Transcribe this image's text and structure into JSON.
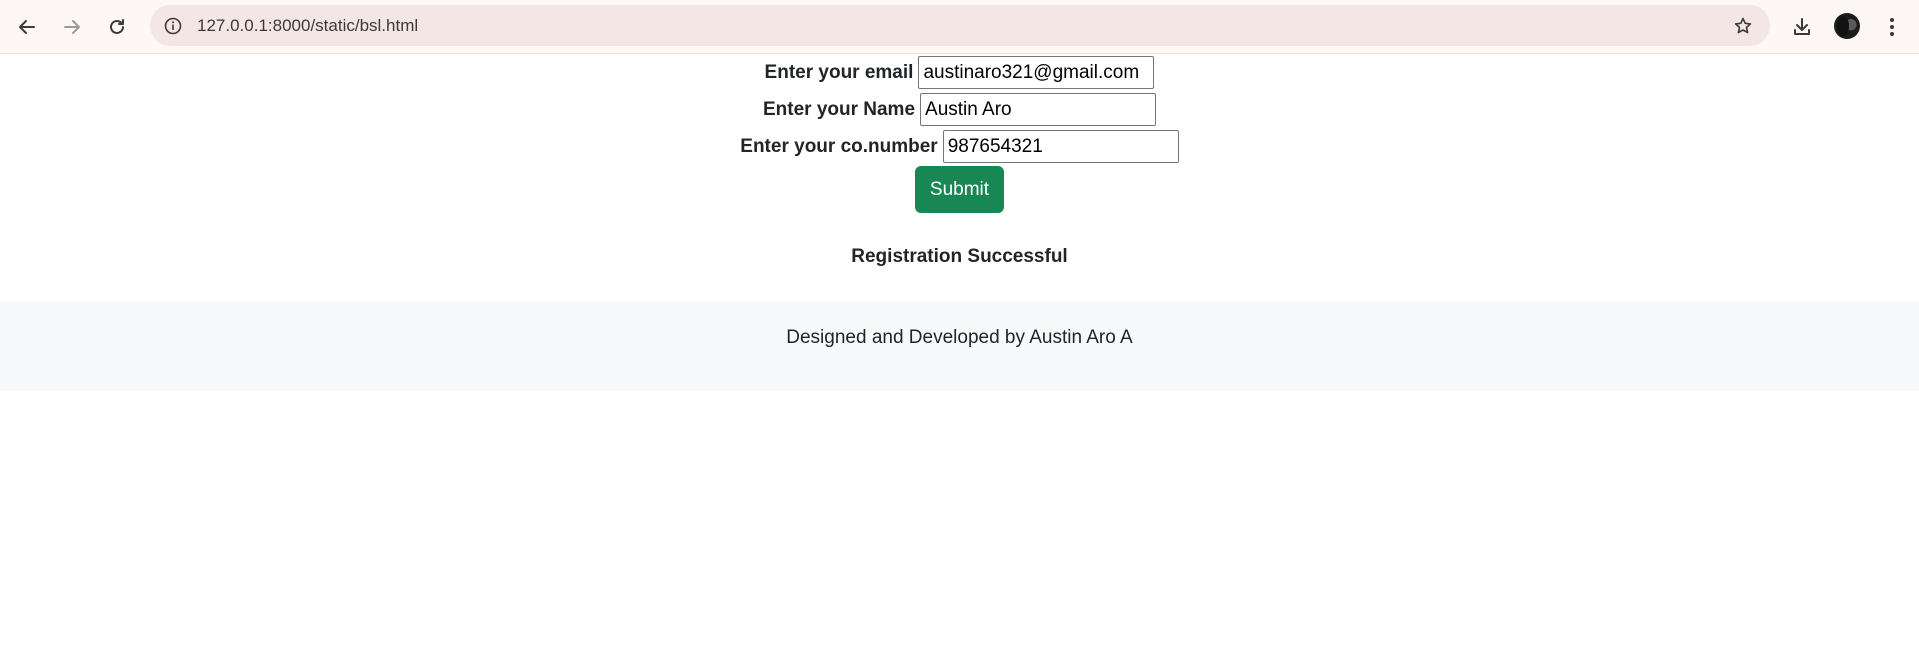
{
  "browser": {
    "url": "127.0.0.1:8000/static/bsl.html",
    "icons": {
      "back": "arrow-left-icon",
      "forward": "arrow-right-icon",
      "reload": "reload-icon",
      "site_info": "info-icon",
      "bookmark": "star-icon",
      "downloads": "download-icon",
      "profile": "avatar",
      "menu": "kebab-menu-icon"
    }
  },
  "form": {
    "email_label": "Enter your email",
    "email_value": "austinaro321@gmail.com",
    "name_label": "Enter your Name",
    "name_value": "Austin Aro",
    "number_label": "Enter your co.number",
    "number_value": "987654321",
    "submit_label": "Submit"
  },
  "status": {
    "message": "Registration Successful"
  },
  "footer": {
    "text": "Designed and Developed by Austin Aro A"
  },
  "colors": {
    "submit_button": "#198754",
    "footer_bg": "#f8f9fa",
    "browser_bar_bg": "#fdf7f6",
    "omnibox_bg": "#f3e6e4"
  }
}
